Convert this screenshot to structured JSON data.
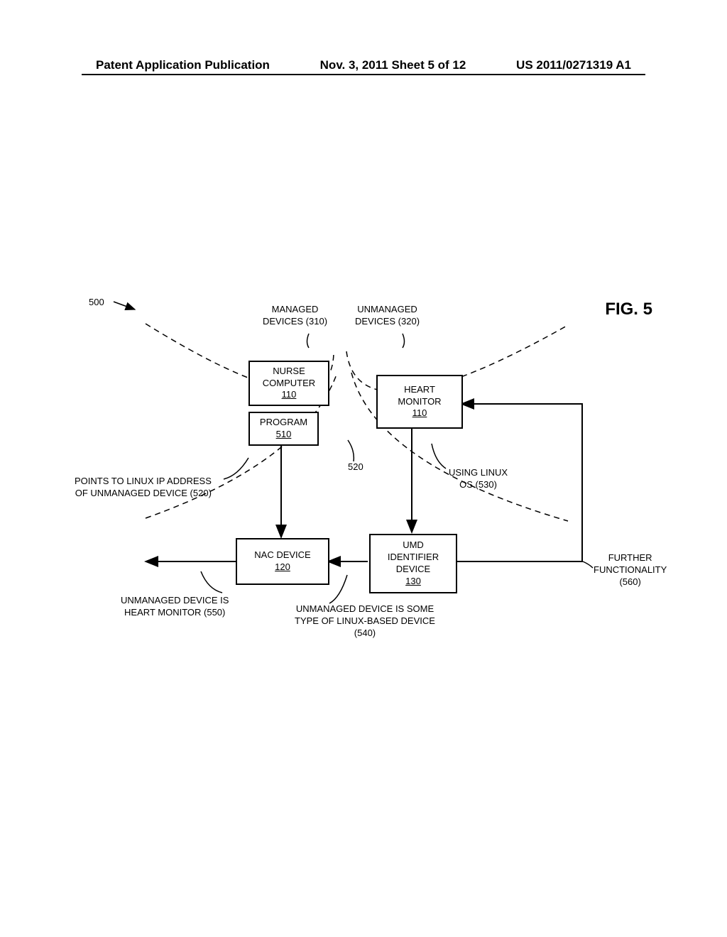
{
  "header": {
    "left": "Patent Application Publication",
    "center": "Nov. 3, 2011  Sheet 5 of 12",
    "right": "US 2011/0271319 A1"
  },
  "figure": {
    "label": "FIG. 5",
    "ref500": "500"
  },
  "groups": {
    "managed": {
      "line1": "MANAGED",
      "line2": "DEVICES (310)"
    },
    "unmanaged": {
      "line1": "UNMANAGED",
      "line2": "DEVICES (320)"
    }
  },
  "boxes": {
    "nurse": {
      "line1": "NURSE",
      "line2": "COMPUTER",
      "ref": "110"
    },
    "program": {
      "line1": "PROGRAM",
      "ref": "510"
    },
    "heart": {
      "line1": "HEART",
      "line2": "MONITOR",
      "ref": "110"
    },
    "nac": {
      "line1": "NAC DEVICE",
      "ref": "120"
    },
    "umd": {
      "line1": "UMD",
      "line2": "IDENTIFIER",
      "line3": "DEVICE",
      "ref": "130"
    }
  },
  "annotations": {
    "points_to": {
      "line1": "POINTS TO LINUX IP ADDRESS",
      "line2": "OF UNMANAGED DEVICE (520)"
    },
    "using_linux": {
      "line1": "USING LINUX",
      "line2": "OS (530)"
    },
    "heart_monitor": {
      "line1": "UNMANAGED DEVICE IS",
      "line2": "HEART MONITOR (550)"
    },
    "linux_based": {
      "line1": "UNMANAGED DEVICE IS SOME",
      "line2": "TYPE OF LINUX-BASED DEVICE",
      "line3": "(540)"
    },
    "further": {
      "line1": "FURTHER",
      "line2": "FUNCTIONALITY",
      "line3": "(560)"
    },
    "ref520": "520"
  }
}
